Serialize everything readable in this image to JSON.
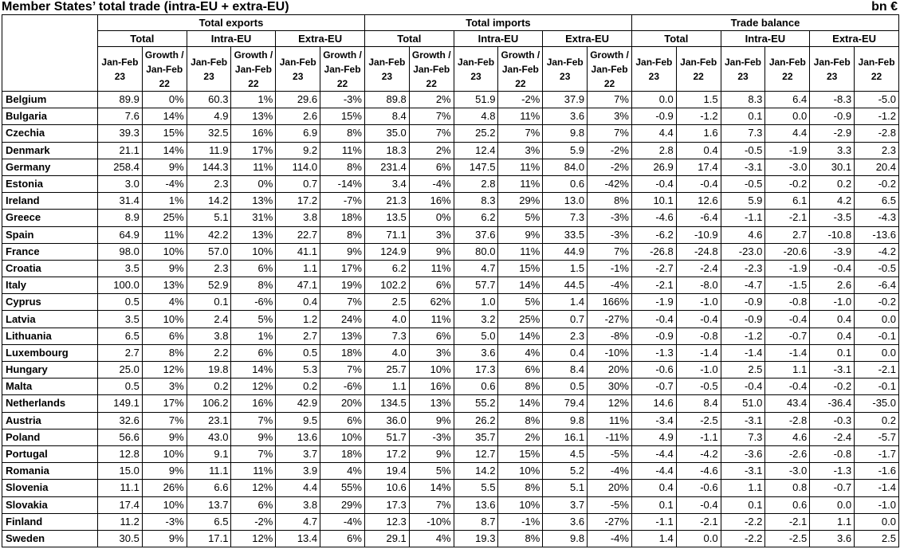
{
  "title": "Member States’ total trade (intra-EU + extra-EU)",
  "unit": "bn €",
  "groups": [
    "Total exports",
    "Total imports",
    "Trade balance"
  ],
  "subgroups": [
    "Total",
    "Intra-EU",
    "Extra-EU",
    "Total",
    "Intra-EU",
    "Extra-EU",
    "Total",
    "Intra-EU",
    "Extra-EU"
  ],
  "colheads": [
    [
      "Jan-Feb",
      "23"
    ],
    [
      "Growth /",
      "Jan-Feb",
      "22"
    ],
    [
      "Jan-Feb",
      "23"
    ],
    [
      "Growth /",
      "Jan-Feb",
      "22"
    ],
    [
      "Jan-Feb",
      "23"
    ],
    [
      "Growth /",
      "Jan-Feb",
      "22"
    ],
    [
      "Jan-Feb",
      "23"
    ],
    [
      "Growth /",
      "Jan-Feb",
      "22"
    ],
    [
      "Jan-Feb",
      "23"
    ],
    [
      "Growth /",
      "Jan-Feb",
      "22"
    ],
    [
      "Jan-Feb",
      "23"
    ],
    [
      "Growth /",
      "Jan-Feb",
      "22"
    ],
    [
      "Jan-Feb",
      "23"
    ],
    [
      "Jan-Feb",
      "22"
    ],
    [
      "Jan-Feb",
      "23"
    ],
    [
      "Jan-Feb",
      "22"
    ],
    [
      "Jan-Feb",
      "23"
    ],
    [
      "Jan-Feb",
      "22"
    ]
  ],
  "rows": [
    {
      "country": "Belgium",
      "values": [
        "89.9",
        "0%",
        "60.3",
        "1%",
        "29.6",
        "-3%",
        "89.8",
        "2%",
        "51.9",
        "-2%",
        "37.9",
        "7%",
        "0.0",
        "1.5",
        "8.3",
        "6.4",
        "-8.3",
        "-5.0"
      ]
    },
    {
      "country": "Bulgaria",
      "values": [
        "7.6",
        "14%",
        "4.9",
        "13%",
        "2.6",
        "15%",
        "8.4",
        "7%",
        "4.8",
        "11%",
        "3.6",
        "3%",
        "-0.9",
        "-1.2",
        "0.1",
        "0.0",
        "-0.9",
        "-1.2"
      ]
    },
    {
      "country": "Czechia",
      "values": [
        "39.3",
        "15%",
        "32.5",
        "16%",
        "6.9",
        "8%",
        "35.0",
        "7%",
        "25.2",
        "7%",
        "9.8",
        "7%",
        "4.4",
        "1.6",
        "7.3",
        "4.4",
        "-2.9",
        "-2.8"
      ]
    },
    {
      "country": "Denmark",
      "values": [
        "21.1",
        "14%",
        "11.9",
        "17%",
        "9.2",
        "11%",
        "18.3",
        "2%",
        "12.4",
        "3%",
        "5.9",
        "-2%",
        "2.8",
        "0.4",
        "-0.5",
        "-1.9",
        "3.3",
        "2.3"
      ]
    },
    {
      "country": "Germany",
      "values": [
        "258.4",
        "9%",
        "144.3",
        "11%",
        "114.0",
        "8%",
        "231.4",
        "6%",
        "147.5",
        "11%",
        "84.0",
        "-2%",
        "26.9",
        "17.4",
        "-3.1",
        "-3.0",
        "30.1",
        "20.4"
      ]
    },
    {
      "country": "Estonia",
      "values": [
        "3.0",
        "-4%",
        "2.3",
        "0%",
        "0.7",
        "-14%",
        "3.4",
        "-4%",
        "2.8",
        "11%",
        "0.6",
        "-42%",
        "-0.4",
        "-0.4",
        "-0.5",
        "-0.2",
        "0.2",
        "-0.2"
      ]
    },
    {
      "country": "Ireland",
      "values": [
        "31.4",
        "1%",
        "14.2",
        "13%",
        "17.2",
        "-7%",
        "21.3",
        "16%",
        "8.3",
        "29%",
        "13.0",
        "8%",
        "10.1",
        "12.6",
        "5.9",
        "6.1",
        "4.2",
        "6.5"
      ]
    },
    {
      "country": "Greece",
      "values": [
        "8.9",
        "25%",
        "5.1",
        "31%",
        "3.8",
        "18%",
        "13.5",
        "0%",
        "6.2",
        "5%",
        "7.3",
        "-3%",
        "-4.6",
        "-6.4",
        "-1.1",
        "-2.1",
        "-3.5",
        "-4.3"
      ]
    },
    {
      "country": "Spain",
      "values": [
        "64.9",
        "11%",
        "42.2",
        "13%",
        "22.7",
        "8%",
        "71.1",
        "3%",
        "37.6",
        "9%",
        "33.5",
        "-3%",
        "-6.2",
        "-10.9",
        "4.6",
        "2.7",
        "-10.8",
        "-13.6"
      ]
    },
    {
      "country": "France",
      "values": [
        "98.0",
        "10%",
        "57.0",
        "10%",
        "41.1",
        "9%",
        "124.9",
        "9%",
        "80.0",
        "11%",
        "44.9",
        "7%",
        "-26.8",
        "-24.8",
        "-23.0",
        "-20.6",
        "-3.9",
        "-4.2"
      ]
    },
    {
      "country": "Croatia",
      "values": [
        "3.5",
        "9%",
        "2.3",
        "6%",
        "1.1",
        "17%",
        "6.2",
        "11%",
        "4.7",
        "15%",
        "1.5",
        "-1%",
        "-2.7",
        "-2.4",
        "-2.3",
        "-1.9",
        "-0.4",
        "-0.5"
      ]
    },
    {
      "country": "Italy",
      "values": [
        "100.0",
        "13%",
        "52.9",
        "8%",
        "47.1",
        "19%",
        "102.2",
        "6%",
        "57.7",
        "14%",
        "44.5",
        "-4%",
        "-2.1",
        "-8.0",
        "-4.7",
        "-1.5",
        "2.6",
        "-6.4"
      ]
    },
    {
      "country": "Cyprus",
      "values": [
        "0.5",
        "4%",
        "0.1",
        "-6%",
        "0.4",
        "7%",
        "2.5",
        "62%",
        "1.0",
        "5%",
        "1.4",
        "166%",
        "-1.9",
        "-1.0",
        "-0.9",
        "-0.8",
        "-1.0",
        "-0.2"
      ]
    },
    {
      "country": "Latvia",
      "values": [
        "3.5",
        "10%",
        "2.4",
        "5%",
        "1.2",
        "24%",
        "4.0",
        "11%",
        "3.2",
        "25%",
        "0.7",
        "-27%",
        "-0.4",
        "-0.4",
        "-0.9",
        "-0.4",
        "0.4",
        "0.0"
      ]
    },
    {
      "country": "Lithuania",
      "values": [
        "6.5",
        "6%",
        "3.8",
        "1%",
        "2.7",
        "13%",
        "7.3",
        "6%",
        "5.0",
        "14%",
        "2.3",
        "-8%",
        "-0.9",
        "-0.8",
        "-1.2",
        "-0.7",
        "0.4",
        "-0.1"
      ]
    },
    {
      "country": "Luxembourg",
      "values": [
        "2.7",
        "8%",
        "2.2",
        "6%",
        "0.5",
        "18%",
        "4.0",
        "3%",
        "3.6",
        "4%",
        "0.4",
        "-10%",
        "-1.3",
        "-1.4",
        "-1.4",
        "-1.4",
        "0.1",
        "0.0"
      ]
    },
    {
      "country": "Hungary",
      "values": [
        "25.0",
        "12%",
        "19.8",
        "14%",
        "5.3",
        "7%",
        "25.7",
        "10%",
        "17.3",
        "6%",
        "8.4",
        "20%",
        "-0.6",
        "-1.0",
        "2.5",
        "1.1",
        "-3.1",
        "-2.1"
      ]
    },
    {
      "country": "Malta",
      "values": [
        "0.5",
        "3%",
        "0.2",
        "12%",
        "0.2",
        "-6%",
        "1.1",
        "16%",
        "0.6",
        "8%",
        "0.5",
        "30%",
        "-0.7",
        "-0.5",
        "-0.4",
        "-0.4",
        "-0.2",
        "-0.1"
      ]
    },
    {
      "country": "Netherlands",
      "values": [
        "149.1",
        "17%",
        "106.2",
        "16%",
        "42.9",
        "20%",
        "134.5",
        "13%",
        "55.2",
        "14%",
        "79.4",
        "12%",
        "14.6",
        "8.4",
        "51.0",
        "43.4",
        "-36.4",
        "-35.0"
      ]
    },
    {
      "country": "Austria",
      "values": [
        "32.6",
        "7%",
        "23.1",
        "7%",
        "9.5",
        "6%",
        "36.0",
        "9%",
        "26.2",
        "8%",
        "9.8",
        "11%",
        "-3.4",
        "-2.5",
        "-3.1",
        "-2.8",
        "-0.3",
        "0.2"
      ]
    },
    {
      "country": "Poland",
      "values": [
        "56.6",
        "9%",
        "43.0",
        "9%",
        "13.6",
        "10%",
        "51.7",
        "-3%",
        "35.7",
        "2%",
        "16.1",
        "-11%",
        "4.9",
        "-1.1",
        "7.3",
        "4.6",
        "-2.4",
        "-5.7"
      ]
    },
    {
      "country": "Portugal",
      "values": [
        "12.8",
        "10%",
        "9.1",
        "7%",
        "3.7",
        "18%",
        "17.2",
        "9%",
        "12.7",
        "15%",
        "4.5",
        "-5%",
        "-4.4",
        "-4.2",
        "-3.6",
        "-2.6",
        "-0.8",
        "-1.7"
      ]
    },
    {
      "country": "Romania",
      "values": [
        "15.0",
        "9%",
        "11.1",
        "11%",
        "3.9",
        "4%",
        "19.4",
        "5%",
        "14.2",
        "10%",
        "5.2",
        "-4%",
        "-4.4",
        "-4.6",
        "-3.1",
        "-3.0",
        "-1.3",
        "-1.6"
      ]
    },
    {
      "country": "Slovenia",
      "values": [
        "11.1",
        "26%",
        "6.6",
        "12%",
        "4.4",
        "55%",
        "10.6",
        "14%",
        "5.5",
        "8%",
        "5.1",
        "20%",
        "0.4",
        "-0.6",
        "1.1",
        "0.8",
        "-0.7",
        "-1.4"
      ]
    },
    {
      "country": "Slovakia",
      "values": [
        "17.4",
        "10%",
        "13.7",
        "6%",
        "3.8",
        "29%",
        "17.3",
        "7%",
        "13.6",
        "10%",
        "3.7",
        "-5%",
        "0.1",
        "-0.4",
        "0.1",
        "0.6",
        "0.0",
        "-1.0"
      ]
    },
    {
      "country": "Finland",
      "values": [
        "11.2",
        "-3%",
        "6.5",
        "-2%",
        "4.7",
        "-4%",
        "12.3",
        "-10%",
        "8.7",
        "-1%",
        "3.6",
        "-27%",
        "-1.1",
        "-2.1",
        "-2.2",
        "-2.1",
        "1.1",
        "0.0"
      ]
    },
    {
      "country": "Sweden",
      "values": [
        "30.5",
        "9%",
        "17.1",
        "12%",
        "13.4",
        "6%",
        "29.1",
        "4%",
        "19.3",
        "8%",
        "9.8",
        "-4%",
        "1.4",
        "0.0",
        "-2.2",
        "-2.5",
        "3.6",
        "2.5"
      ]
    }
  ]
}
